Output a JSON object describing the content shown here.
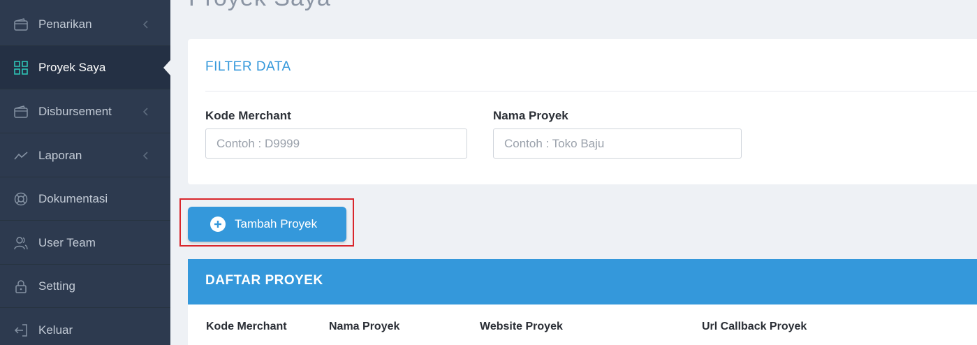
{
  "sidebar": {
    "items": [
      {
        "label": "Penarikan",
        "icon": "wallet-icon",
        "has_chevron": true
      },
      {
        "label": "Proyek Saya",
        "icon": "grid-icon",
        "active": true
      },
      {
        "label": "Disbursement",
        "icon": "wallet-icon",
        "has_chevron": true
      },
      {
        "label": "Laporan",
        "icon": "chart-line-icon",
        "has_chevron": true
      },
      {
        "label": "Dokumentasi",
        "icon": "lifebuoy-icon"
      },
      {
        "label": "User Team",
        "icon": "users-icon"
      },
      {
        "label": "Setting",
        "icon": "lock-icon"
      },
      {
        "label": "Keluar",
        "icon": "logout-icon"
      }
    ]
  },
  "page": {
    "title": "Proyek Saya"
  },
  "filter": {
    "title": "FILTER DATA",
    "kode_label": "Kode Merchant",
    "kode_placeholder": "Contoh : D9999",
    "nama_label": "Nama Proyek",
    "nama_placeholder": "Contoh : Toko Baju"
  },
  "actions": {
    "add_label": "Tambah Proyek"
  },
  "list": {
    "title": "DAFTAR PROYEK",
    "columns": [
      "Kode Merchant",
      "Nama Proyek",
      "Website Proyek",
      "Url Callback Proyek"
    ]
  },
  "colors": {
    "sidebar_bg": "#2d3a4f",
    "accent": "#3498db",
    "active_icon": "#2ec4b6",
    "highlight": "#d9262c"
  }
}
